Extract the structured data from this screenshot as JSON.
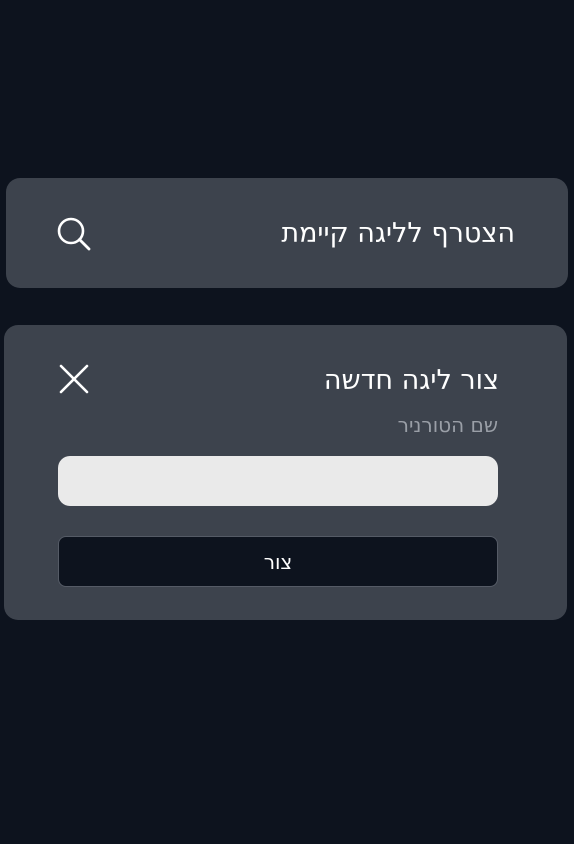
{
  "join": {
    "title": "הצטרף לליגה קיימת",
    "icon": "search-icon"
  },
  "create": {
    "title": "צור ליגה חדשה",
    "close_icon": "close-icon",
    "field_label": "שם הטורניר",
    "input_value": "",
    "button_label": "צור"
  },
  "colors": {
    "background": "#0d131e",
    "card": "#3d434d",
    "input": "#eaeaea",
    "label": "#9a9fa7",
    "text": "#ffffff"
  }
}
